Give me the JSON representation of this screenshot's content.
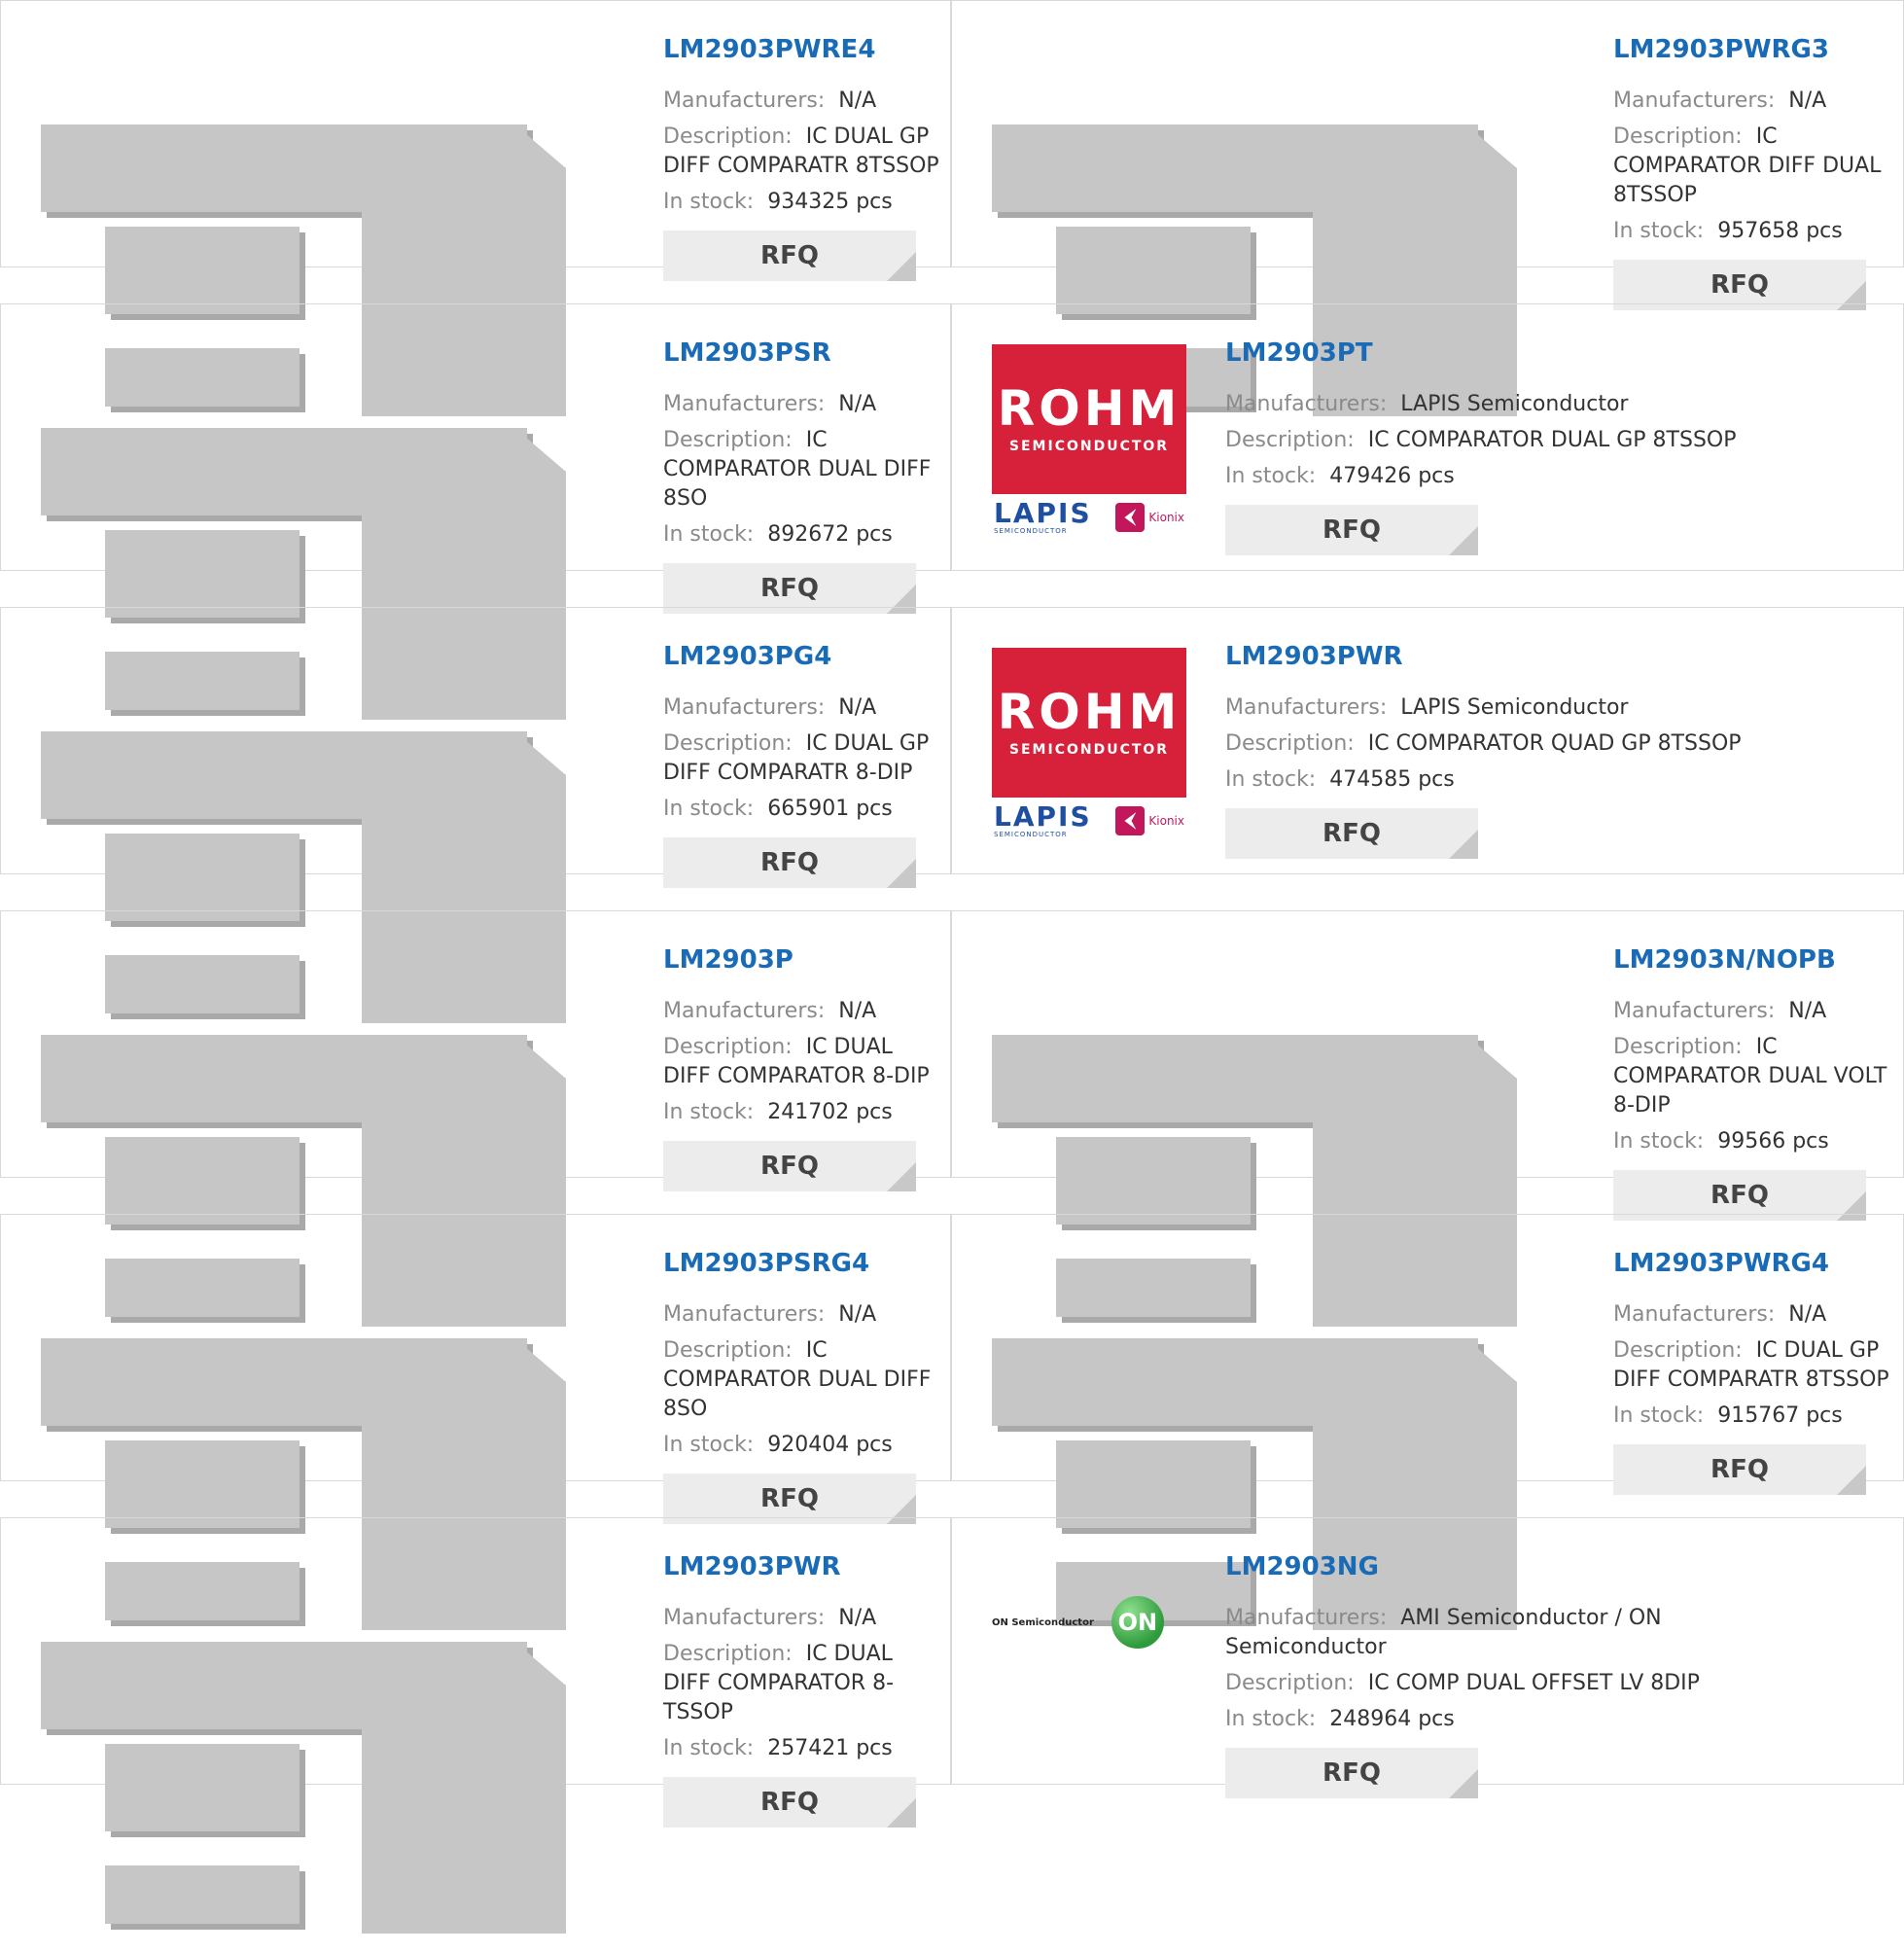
{
  "labels": {
    "manufacturers": "Manufacturers:",
    "description": "Description:",
    "in_stock": "In stock:",
    "rfq": "RFQ"
  },
  "logos": {
    "rohm_word": "ROHM",
    "rohm_sub": "SEMICONDUCTOR",
    "lapis_word": "LAPIS",
    "lapis_sub": "SEMICONDUCTOR",
    "kionix": "Kionix",
    "on_text": "ON Semiconductor",
    "on_mark": "ON"
  },
  "products": [
    {
      "part": "LM2903PWRE4",
      "manufacturer": "N/A",
      "description": "IC DUAL GP DIFF COMPARATR 8TSSOP",
      "stock": "934325 pcs",
      "logo": "chip"
    },
    {
      "part": "LM2903PWRG3",
      "manufacturer": "N/A",
      "description": "IC COMPARATOR DIFF DUAL 8TSSOP",
      "stock": "957658 pcs",
      "logo": "chip"
    },
    {
      "part": "LM2903PSR",
      "manufacturer": "N/A",
      "description": "IC COMPARATOR DUAL DIFF 8SO",
      "stock": "892672 pcs",
      "logo": "chip"
    },
    {
      "part": "LM2903PT",
      "manufacturer": "LAPIS Semiconductor",
      "description": "IC COMPARATOR DUAL GP 8TSSOP",
      "stock": "479426 pcs",
      "logo": "rohm"
    },
    {
      "part": "LM2903PG4",
      "manufacturer": "N/A",
      "description": "IC DUAL GP DIFF COMPARATR 8-DIP",
      "stock": "665901 pcs",
      "logo": "chip"
    },
    {
      "part": "LM2903PWR",
      "manufacturer": "LAPIS Semiconductor",
      "description": "IC COMPARATOR QUAD GP 8TSSOP",
      "stock": "474585 pcs",
      "logo": "rohm"
    },
    {
      "part": "LM2903P",
      "manufacturer": "N/A",
      "description": "IC DUAL DIFF COMPARATOR 8-DIP",
      "stock": "241702 pcs",
      "logo": "chip"
    },
    {
      "part": "LM2903N/NOPB",
      "manufacturer": "N/A",
      "description": "IC COMPARATOR DUAL VOLT 8-DIP",
      "stock": "99566 pcs",
      "logo": "chip"
    },
    {
      "part": "LM2903PSRG4",
      "manufacturer": "N/A",
      "description": "IC COMPARATOR DUAL DIFF 8SO",
      "stock": "920404 pcs",
      "logo": "chip"
    },
    {
      "part": "LM2903PWRG4",
      "manufacturer": "N/A",
      "description": "IC DUAL GP DIFF COMPARATR 8TSSOP",
      "stock": "915767 pcs",
      "logo": "chip"
    },
    {
      "part": "LM2903PWR",
      "manufacturer": "N/A",
      "description": "IC DUAL DIFF COMPARATOR 8-TSSOP",
      "stock": "257421 pcs",
      "logo": "chip"
    },
    {
      "part": "LM2903NG",
      "manufacturer": "AMI Semiconductor / ON Semiconductor",
      "description": "IC COMP DUAL OFFSET LV 8DIP",
      "stock": "248964 pcs",
      "logo": "on"
    }
  ]
}
